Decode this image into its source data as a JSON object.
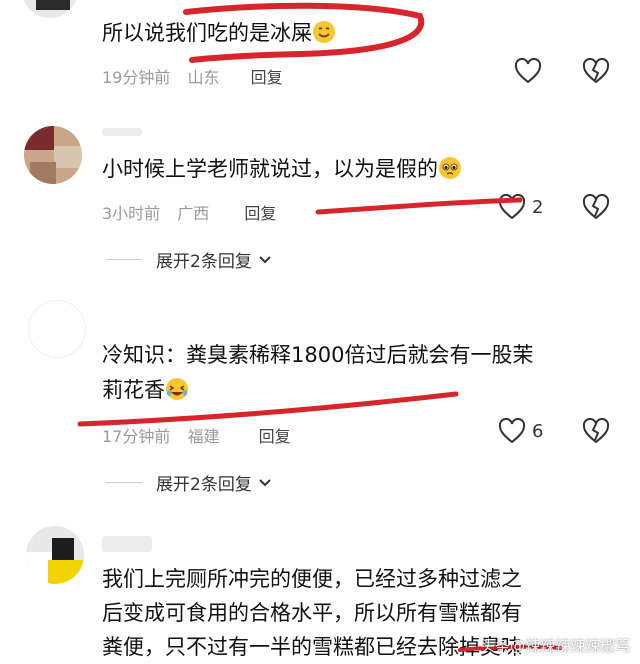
{
  "comments": [
    {
      "text": "所以说我们吃的是冰屎",
      "time": "19分钟前",
      "location": "山东",
      "reply": "回复",
      "likes": "",
      "emoji": "smile-emoji"
    },
    {
      "text": "小时候上学老师就说过，以为是假的",
      "time": "3小时前",
      "location": "广西",
      "reply": "回复",
      "likes": "2",
      "expand": "展开2条回复",
      "emoji": "pleading-emoji"
    },
    {
      "text_line1": "冷知识：粪臭素稀释1800倍过后就会有一股茉",
      "text_line2": "莉花香",
      "time": "17分钟前",
      "location": "福建",
      "reply": "回复",
      "likes": "6",
      "expand": "展开2条回复",
      "emoji": "laughing-emoji"
    },
    {
      "text_line1": "我们上完厕所冲完的便便，已经过多种过滤之",
      "text_line2": "后变成可食用的合格水平，所以所有雪糕都有",
      "text_line3": "粪便，只不过有一半的雪糕都已经去除掉臭味"
    }
  ],
  "watermark": "头条@辣辣辣辣辣椒骂",
  "colors": {
    "annotation": "#d7262b",
    "meta": "#9a9a9a"
  }
}
